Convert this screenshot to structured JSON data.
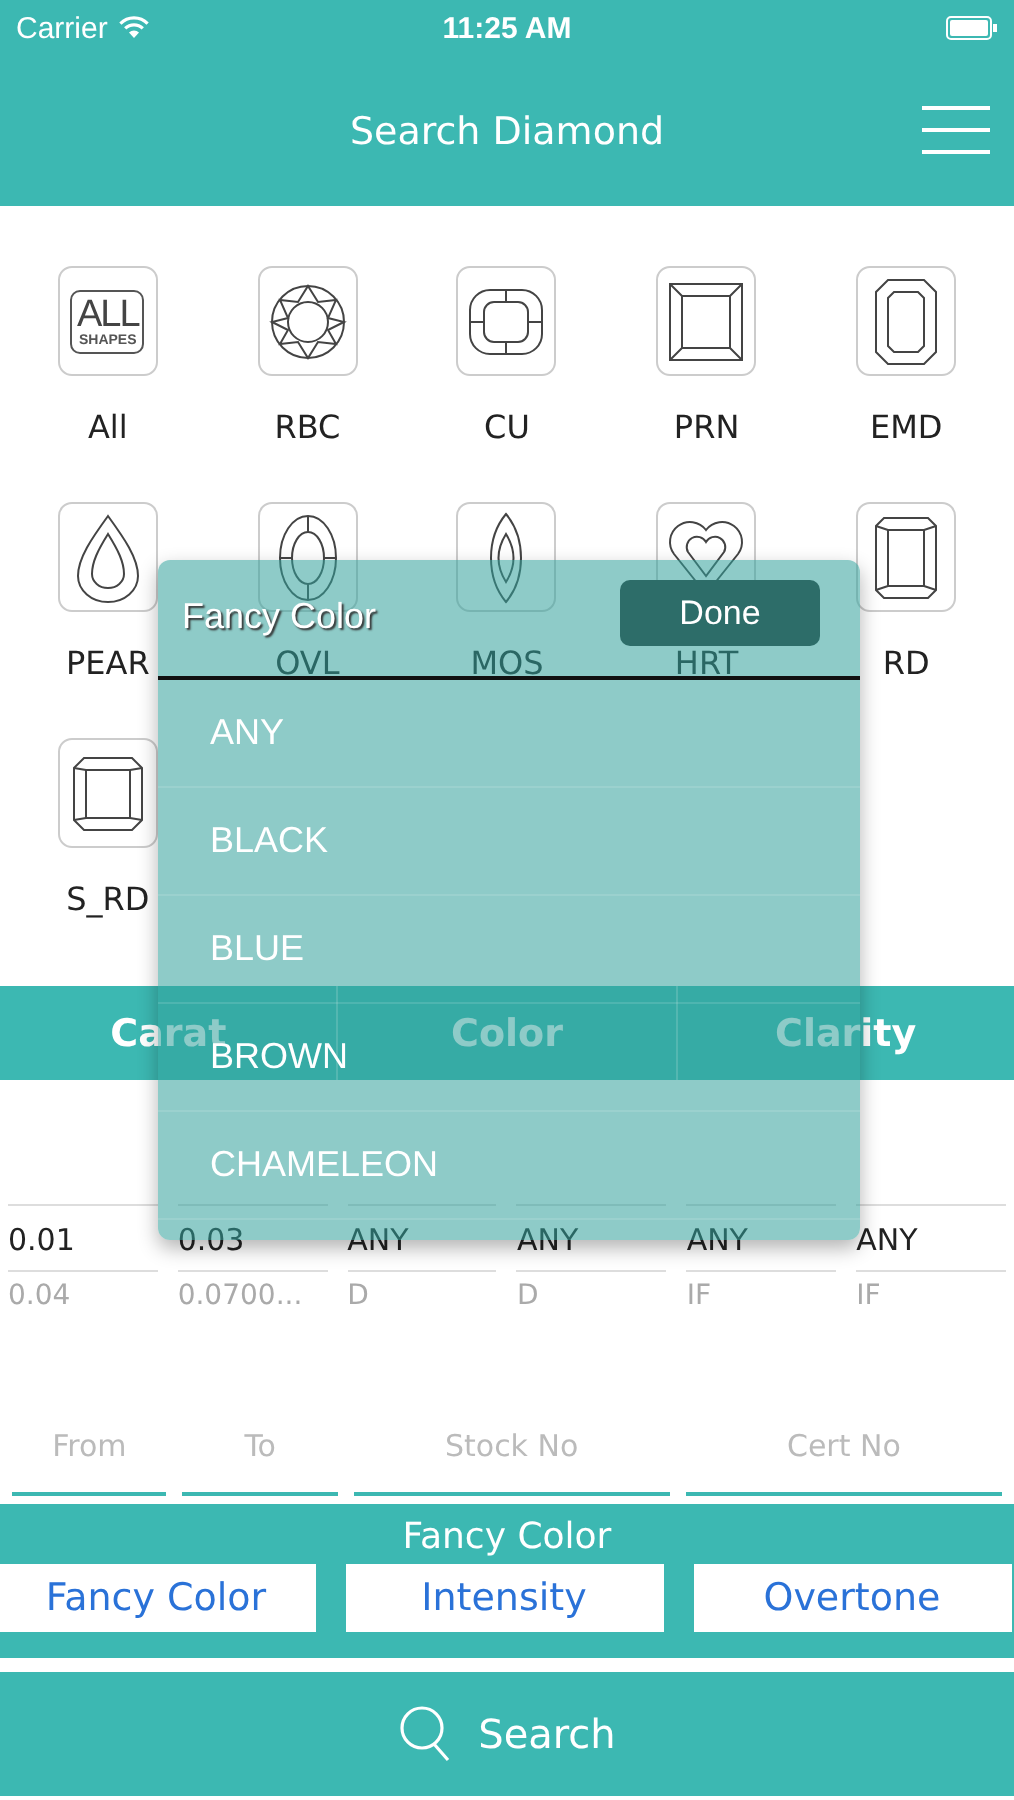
{
  "status_bar": {
    "carrier": "Carrier",
    "time": "11:25 AM"
  },
  "nav": {
    "title": "Search Diamond"
  },
  "shapes": [
    {
      "kind": "all",
      "label": "All",
      "icon_text": "ALL",
      "icon_subtext": "SHAPES"
    },
    {
      "kind": "round",
      "label": "RBC"
    },
    {
      "kind": "cushion",
      "label": "CU"
    },
    {
      "kind": "princess",
      "label": "PRN"
    },
    {
      "kind": "emerald",
      "label": "EMD"
    },
    {
      "kind": "pear",
      "label": "PEAR"
    },
    {
      "kind": "oval",
      "label": "OVL"
    },
    {
      "kind": "marquise",
      "label": "MOS"
    },
    {
      "kind": "heart",
      "label": "HRT"
    },
    {
      "kind": "radiant",
      "label": "RD"
    },
    {
      "kind": "square_radiant",
      "label": "S_RD"
    }
  ],
  "tabs": [
    "Carat",
    "Color",
    "Clarity"
  ],
  "pickers": [
    {
      "current": "0.01",
      "next": "0.04"
    },
    {
      "current": "0.03",
      "next": "0.0700..."
    },
    {
      "current": "ANY",
      "next": "D"
    },
    {
      "current": "ANY",
      "next": "D"
    },
    {
      "current": "ANY",
      "next": "IF"
    },
    {
      "current": "ANY",
      "next": "IF"
    }
  ],
  "fields": [
    {
      "placeholder": "From"
    },
    {
      "placeholder": "To"
    },
    {
      "placeholder": "Stock No"
    },
    {
      "placeholder": "Cert No"
    }
  ],
  "fancy_section": {
    "title": "Fancy Color",
    "buttons": [
      "Fancy Color",
      "Intensity",
      "Overtone"
    ]
  },
  "search_button": {
    "label": "Search"
  },
  "popup": {
    "title": "Fancy Color",
    "done": "Done",
    "options": [
      "ANY",
      "BLACK",
      "BLUE",
      "BROWN",
      "CHAMELEON"
    ]
  }
}
